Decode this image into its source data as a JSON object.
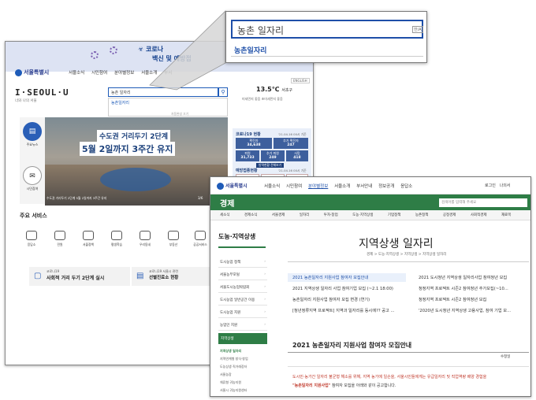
{
  "seoul": {
    "logo": "서울특별시",
    "nav": [
      "서울소식",
      "시민참여",
      "분야별정보",
      "서울소개",
      "부서"
    ],
    "covid_banner": "코로나",
    "covid_banner_sub": "백신 및 예방접",
    "brand": "I·SEOUL·U",
    "brand_sub": "너와 나의 서울",
    "search_value": "농촌 일자리",
    "suggestion": "농촌일자리",
    "suggest_footer": "자동완성 끄기",
    "weather": "13.5℃",
    "weather_unit": "서초구",
    "weather_sub": "미세먼지 좋음 초미세먼지 좋음",
    "lang": "ENGLISH",
    "side": [
      {
        "label": "주요뉴스",
        "icon": "news-icon"
      },
      {
        "label": "시민참여",
        "icon": "chat-icon"
      }
    ],
    "hero_title": "수도권 거리두기 2단계",
    "hero_title2": "5월 2일까지 3주간 유지",
    "hero_caption": "수도권 거리두기 2단계 5월 2일까지 3주간 유지",
    "hero_page": "3/6",
    "covid_status": {
      "title": "코로나19 현황",
      "date": "'21.04.16 00시 기준",
      "cells": [
        {
          "label": "확진자",
          "value": "34,638"
        },
        {
          "label": "추가 확진자",
          "value": "247"
        },
        {
          "label": "퇴원",
          "value": "31,733"
        },
        {
          "label": "추가 퇴원",
          "value": "249"
        },
        {
          "label": "사망",
          "value": "418"
        }
      ],
      "button": "방역현황 전체보기"
    },
    "vaccine": {
      "title": "예방접종현황",
      "date": "'21.04.16 00시 기준",
      "cells": [
        "1차 접종",
        "2차 접종",
        "이상반응"
      ]
    },
    "services_title": "주요 서비스",
    "services": [
      "응답소",
      "민원",
      "서울정책",
      "평생학습",
      "우리동네",
      "부동산",
      "공공서비스"
    ],
    "notice1_tag": "코로나19",
    "notice1": "사회적 거리 두기 2단계 실시",
    "notice2_tag": "코로나19 서울시 관련",
    "notice2": "선별진료소 현황"
  },
  "zoom": {
    "search_value": "농촌 일자리",
    "suggestion": "농촌일자리",
    "kbd": "한/A"
  },
  "economy": {
    "logo": "서울특별시",
    "nav": [
      "서울소식",
      "시민참여",
      "분야별정보",
      "서울소개",
      "부서안내",
      "정보공개",
      "응답소"
    ],
    "nav_active": 2,
    "util": [
      "로그인",
      "나의서"
    ],
    "section": "경제",
    "search_placeholder": "검색어를 입력해 주세요",
    "subnav": [
      "세소식",
      "경제소식",
      "서울경제",
      "일자리",
      "투자·창업",
      "도농·지역상생",
      "기업정책",
      "농촌정책",
      "공정경제",
      "사회적경제",
      "재료목"
    ],
    "side_title": "도농·지역상생",
    "side_items": [
      "도시농업 정책",
      "서울농부포털",
      "서울도시농업박람회",
      "도시농업 일반공간 이용",
      "도시농업 지원",
      "농업인 지원"
    ],
    "side_selected": "지역상생",
    "side_subs": [
      "지역상생 일자리",
      "지역연계형 창식·창업",
      "도농상생 직거래장터",
      "서울농장",
      "체류형 귀농지원",
      "서울시 귀농지원센터"
    ],
    "page_title": "지역상생 일자리",
    "breadcrumb": "경제 > 도농·지역상생 > 지역상생 > 지역상생 일자리",
    "list_left": [
      "2021 농촌일자리 지원사업 참여자 모집안내",
      "2021 지역상생 일자리 사업 참여기업 모집 (~2.1 18:00)",
      "농촌일자리 지원사업 참여자 모집 변경 (연기)",
      "[청년정류지역 프로젝트] 지역과 일자리를 동시에?? 공고 ..."
    ],
    "list_right": [
      "2021 도시청년 지역상생 일자리사업 참여청년 모집",
      "청정지역 프로젝트 시즌2 참여청년 추가모집(~10...",
      "청정지역 프로젝트 시즌2 참여청년 모집",
      "'2020년 도시청년 지역상생 고용사업, 참여 기업 모..."
    ],
    "notice_title": "2021 농촌일자리 지원사업 참여자 모집안내",
    "notice_author": "수정일",
    "body1": "도시민·농가간 일자리 불균형 해소를 위해, 지역 농가에 일손을, 서울시민들에게는 유급일자리 및 직업역량 배양 경험을",
    "body2_bold": "\"농촌일자리 지원사업\"",
    "body2": " 참여자 모집을 아래와 같이 공고합니다."
  }
}
